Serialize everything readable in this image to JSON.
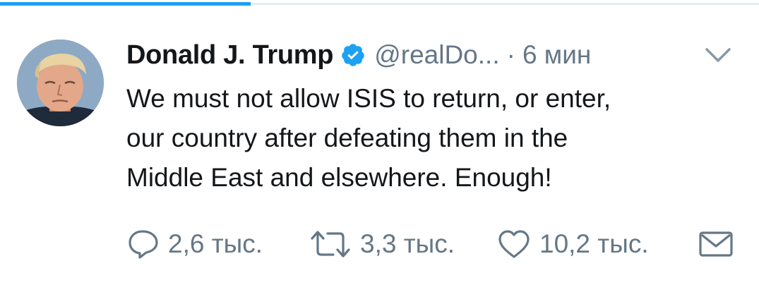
{
  "tweet": {
    "display_name": "Donald J. Trump",
    "handle": "@realDo...",
    "separator": "·",
    "time": "6 мин",
    "verified": true,
    "text_lines": [
      "We must not allow ISIS to return, or enter,",
      "our country after defeating them in the",
      "Middle East and elsewhere. Enough!"
    ]
  },
  "actions": {
    "reply_count": "2,6 тыс.",
    "retweet_count": "3,3 тыс.",
    "like_count": "10,2 тыс."
  },
  "icons": {
    "verified": "verified-badge-icon",
    "more": "chevron-down-icon",
    "reply": "reply-bubble-icon",
    "retweet": "retweet-icon",
    "like": "heart-icon",
    "dm": "envelope-icon"
  },
  "colors": {
    "accent": "#1da1f2",
    "text": "#14171a",
    "secondary": "#657786"
  }
}
